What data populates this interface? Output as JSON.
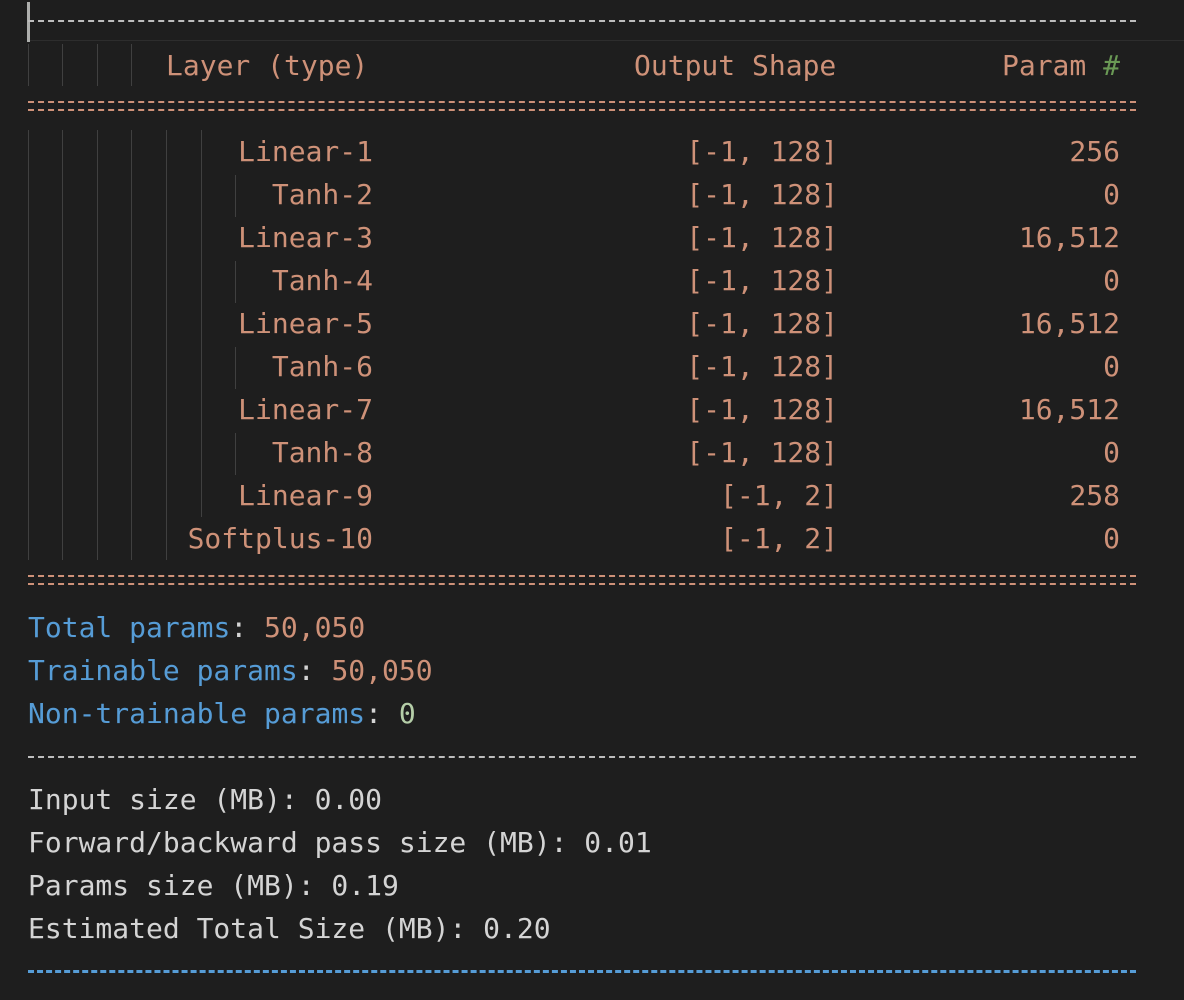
{
  "header": {
    "layer_label": "Layer (type)",
    "shape_label": "Output Shape",
    "param_label": "Param",
    "param_hash": "#"
  },
  "layers": [
    {
      "name": "Linear-1",
      "shape": "[-1, 128]",
      "params": "256"
    },
    {
      "name": "Tanh-2",
      "shape": "[-1, 128]",
      "params": "0"
    },
    {
      "name": "Linear-3",
      "shape": "[-1, 128]",
      "params": "16,512"
    },
    {
      "name": "Tanh-4",
      "shape": "[-1, 128]",
      "params": "0"
    },
    {
      "name": "Linear-5",
      "shape": "[-1, 128]",
      "params": "16,512"
    },
    {
      "name": "Tanh-6",
      "shape": "[-1, 128]",
      "params": "0"
    },
    {
      "name": "Linear-7",
      "shape": "[-1, 128]",
      "params": "16,512"
    },
    {
      "name": "Tanh-8",
      "shape": "[-1, 128]",
      "params": "0"
    },
    {
      "name": "Linear-9",
      "shape": "[-1, 2]",
      "params": "258"
    },
    {
      "name": "Softplus-10",
      "shape": "[-1, 2]",
      "params": "0"
    }
  ],
  "totals": {
    "total_a": "Total",
    "total_b": "params",
    "total_value": "50,050",
    "trainable_a": "Trainable",
    "trainable_b": "params",
    "trainable_value": "50,050",
    "nontrainable_a": "Non-trainable",
    "nontrainable_b": "params",
    "nontrainable_value": "0"
  },
  "sizes": [
    "Input size (MB): 0.00",
    "Forward/backward pass size (MB): 0.01",
    "Params size (MB): 0.19",
    "Estimated Total Size (MB): 0.20"
  ],
  "colors": {
    "background": "#1e1e1e",
    "string": "#ce9178",
    "keyword": "#569cd6",
    "number": "#b5cea8",
    "comment": "#6a9955",
    "text": "#d4d4d4"
  }
}
